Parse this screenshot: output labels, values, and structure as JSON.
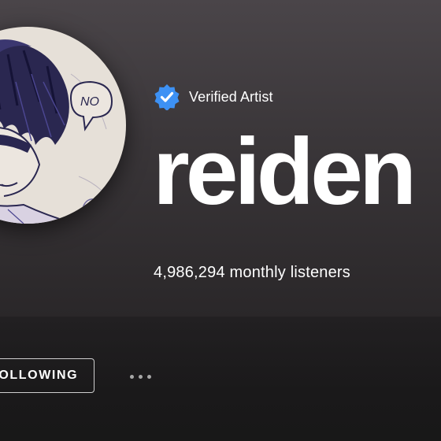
{
  "artist": {
    "verified_label": "Verified Artist",
    "name": "reiden",
    "monthly_listeners": "4,986,294 monthly listeners",
    "avatar_speech_text": "NO"
  },
  "actions": {
    "following_label": "FOLLOWING",
    "more_options_icon": "more-horizontal-icon"
  },
  "colors": {
    "verified_badge": "#3d91f4",
    "text": "#ffffff",
    "hero_top": "#4a4549",
    "hero_bottom": "#2a2729",
    "background": "#181818"
  },
  "icons": {
    "verified": "verified-badge-icon"
  }
}
